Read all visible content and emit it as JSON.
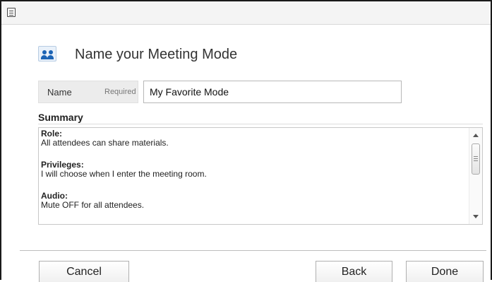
{
  "window": {
    "icon": "document-icon"
  },
  "dialog": {
    "icon": "meeting-attendees-icon",
    "title": "Name your Meeting Mode"
  },
  "name_field": {
    "label": "Name",
    "required_label": "Required",
    "value": "My Favorite Mode"
  },
  "summary": {
    "heading": "Summary",
    "sections": [
      {
        "title": "Role:",
        "text": "All attendees can share materials."
      },
      {
        "title": "Privileges:",
        "text": "I will choose when I enter the meeting room."
      },
      {
        "title": "Audio:",
        "text": "Mute OFF for all attendees."
      }
    ]
  },
  "footer": {
    "cancel_label": "Cancel",
    "back_label": "Back",
    "done_label": "Done"
  },
  "colors": {
    "accent": "#1c64b5",
    "titlebar": "#f4f4f4",
    "name_label_bg": "#ececec"
  }
}
